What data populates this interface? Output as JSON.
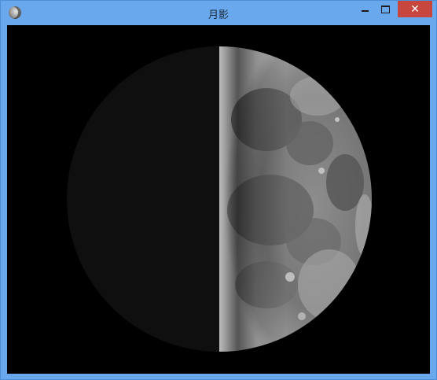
{
  "window": {
    "title": "月影",
    "controls": {
      "minimize_icon": "minimize-icon",
      "maximize_icon": "maximize-icon",
      "close_icon": "close-icon",
      "close_glyph": "✕"
    },
    "colors": {
      "frame": "#6aa8ee",
      "close_button": "#c7463e",
      "client_background": "#000000"
    }
  },
  "content": {
    "image": "moon-phase-image",
    "phase": "first-quarter"
  }
}
